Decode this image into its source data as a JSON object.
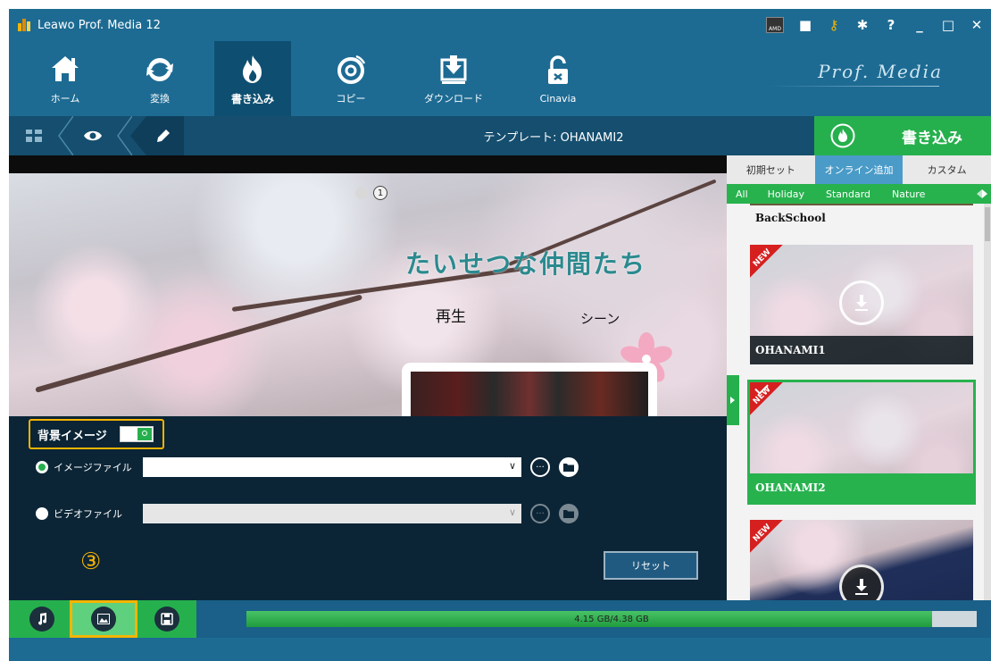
{
  "app": {
    "title": "Leawo Prof. Media 12",
    "brand": "Prof. Media"
  },
  "title_controls": [
    {
      "name": "amd-icon",
      "glyph": "AMD"
    },
    {
      "name": "chat-icon",
      "glyph": "■"
    },
    {
      "name": "key-icon",
      "glyph": "⚷"
    },
    {
      "name": "gear-icon",
      "glyph": "✱"
    },
    {
      "name": "help-icon",
      "glyph": "?"
    },
    {
      "name": "minimize-icon",
      "glyph": "_"
    },
    {
      "name": "maximize-icon",
      "glyph": "□"
    },
    {
      "name": "close-icon",
      "glyph": "✕"
    }
  ],
  "nav": {
    "home": "ホーム",
    "convert": "変換",
    "burn": "書き込み",
    "copy": "コピー",
    "download": "ダウンロード",
    "cinavia": "Cinavia"
  },
  "crumbbar": {
    "template_label": "テンプレート: OHANAMI2",
    "burn_label": "書き込み"
  },
  "preview": {
    "page_number": "1",
    "title": "たいせつな仲間たち",
    "menu_play": "再生",
    "menu_scene": "シーン"
  },
  "settings": {
    "bg_image_label": "背景イメージ",
    "image_file_label": "イメージファイル",
    "video_file_label": "ビデオファイル",
    "image_path": "",
    "video_path": "",
    "more_glyph": "···",
    "step_marker": "③",
    "reset_label": "リセット"
  },
  "sidebar": {
    "tabs": [
      "初期セット",
      "オンライン追加",
      "カスタム"
    ],
    "active_tab": 1,
    "categories": [
      "All",
      "Holiday",
      "Standard",
      "Nature"
    ],
    "templates": [
      {
        "name": "BackSchool",
        "is_new": false
      },
      {
        "name": "OHANAMI1",
        "is_new": true
      },
      {
        "name": "OHANAMI2",
        "is_new": true,
        "selected": true
      },
      {
        "name": "",
        "is_new": true
      }
    ],
    "new_badge": "NEW"
  },
  "progress": {
    "text": "4.15 GB/4.38 GB",
    "used_gb": 4.15,
    "total_gb": 4.38,
    "fill_fraction": 0.939
  },
  "colors": {
    "header_blue": "#1d6b93",
    "accent_green": "#26b04d",
    "highlight_orange": "#f5b400",
    "active_tab_blue": "#4a9bc8"
  }
}
